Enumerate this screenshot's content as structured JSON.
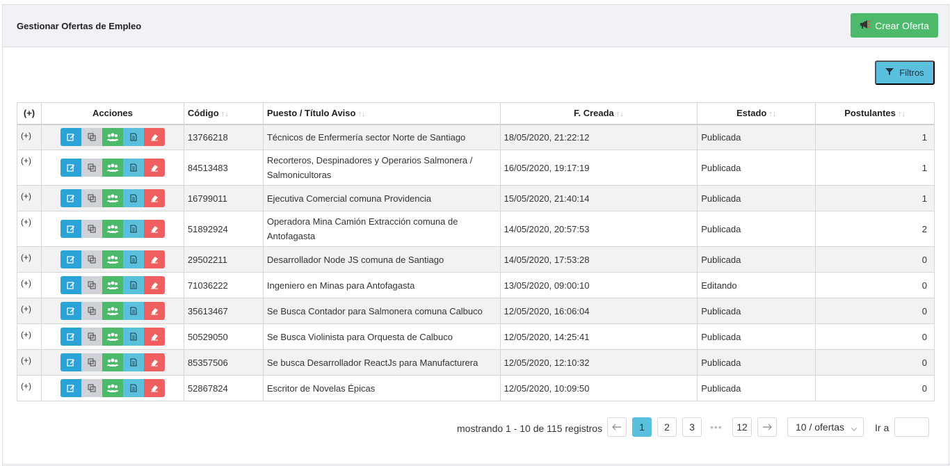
{
  "header": {
    "title": "Gestionar Ofertas de Empleo",
    "create_label": "Crear Oferta",
    "filter_label": "Filtros"
  },
  "table": {
    "columns": {
      "expand": "(+)",
      "actions": "Acciones",
      "code": "Código",
      "title": "Puesto / Título Aviso",
      "created": "F. Creada",
      "status": "Estado",
      "applicants": "Postulantes"
    },
    "rows": [
      {
        "expand": "(+)",
        "code": "13766218",
        "title": "Técnicos de Enfermería sector Norte de Santiago",
        "created": "18/05/2020, 21:22:12",
        "status": "Publicada",
        "applicants": "1"
      },
      {
        "expand": "(+)",
        "code": "84513483",
        "title": "Recorteros, Despinadores y Operarios Salmonera / Salmonicultoras",
        "created": "16/05/2020, 19:17:19",
        "status": "Publicada",
        "applicants": "1"
      },
      {
        "expand": "(+)",
        "code": "16799011",
        "title": "Ejecutiva Comercial comuna Providencia",
        "created": "15/05/2020, 21:40:14",
        "status": "Publicada",
        "applicants": "1"
      },
      {
        "expand": "(+)",
        "code": "51892924",
        "title": "Operadora Mina Camión Extracción comuna de Antofagasta",
        "created": "14/05/2020, 20:57:53",
        "status": "Publicada",
        "applicants": "2"
      },
      {
        "expand": "(+)",
        "code": "29502211",
        "title": "Desarrollador Node JS comuna de Santiago",
        "created": "14/05/2020, 17:53:28",
        "status": "Publicada",
        "applicants": "0"
      },
      {
        "expand": "(+)",
        "code": "71036222",
        "title": "Ingeniero en Minas para Antofagasta",
        "created": "13/05/2020, 09:00:10",
        "status": "Editando",
        "applicants": "0"
      },
      {
        "expand": "(+)",
        "code": "35613467",
        "title": "Se Busca Contador para Salmonera comuna Calbuco",
        "created": "12/05/2020, 16:06:04",
        "status": "Publicada",
        "applicants": "0"
      },
      {
        "expand": "(+)",
        "code": "50529050",
        "title": "Se Busca Violinista para Orquesta de Calbuco",
        "created": "12/05/2020, 14:25:41",
        "status": "Publicada",
        "applicants": "0"
      },
      {
        "expand": "(+)",
        "code": "85357506",
        "title": "Se busca Desarrollador ReactJs para Manufacturera",
        "created": "12/05/2020, 12:10:32",
        "status": "Publicada",
        "applicants": "0"
      },
      {
        "expand": "(+)",
        "code": "52867824",
        "title": "Escritor de Novelas Épicas",
        "created": "12/05/2020, 10:09:50",
        "status": "Publicada",
        "applicants": "0"
      }
    ]
  },
  "pagination": {
    "info": "mostrando 1 - 10 de 115 registros",
    "pages": [
      "1",
      "2",
      "3"
    ],
    "last_page": "12",
    "ellipsis": "•••",
    "current": "1",
    "page_size": "10 / ofertas",
    "goto_label": "Ir a",
    "goto_value": ""
  },
  "colors": {
    "create": "#4cb96b",
    "filter": "#5bc0de",
    "edit": "#2aa3d6",
    "copy": "#cfd3d8",
    "users": "#4cb96b",
    "doc": "#5bc0de",
    "erase": "#f05f5f"
  },
  "icons": {
    "create": "megaphone-icon",
    "filter": "funnel-icon",
    "sort": "sort-arrows-icon",
    "actions": [
      "edit-icon",
      "copy-icon",
      "users-icon",
      "document-icon",
      "eraser-icon"
    ],
    "prev": "arrow-left-icon",
    "next": "arrow-right-icon",
    "caret": "chevron-down-icon"
  }
}
